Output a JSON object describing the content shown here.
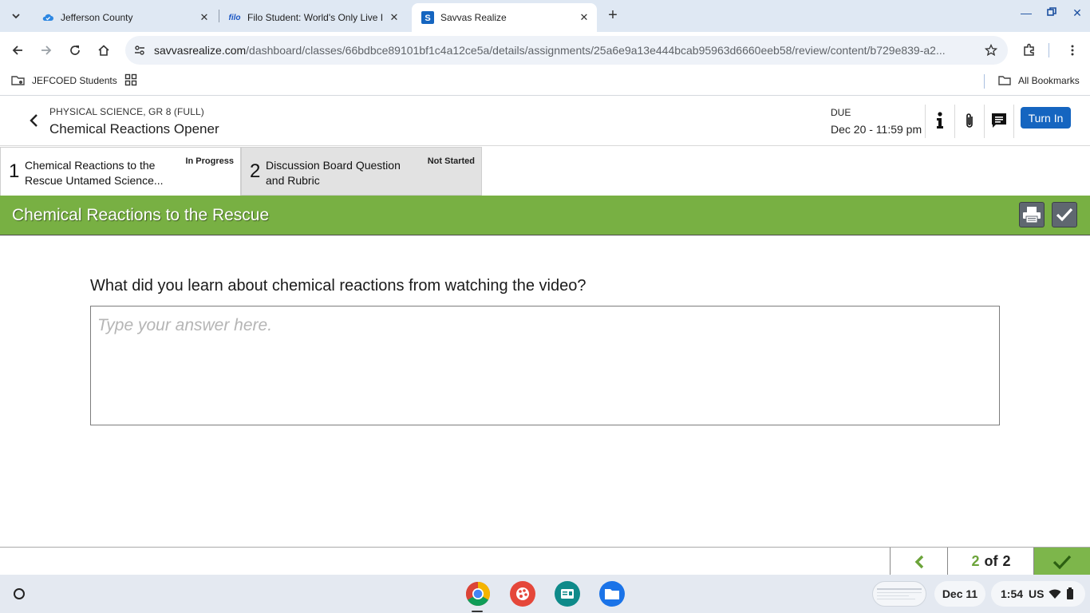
{
  "browser": {
    "tabs": [
      {
        "title": "Jefferson County",
        "active": false
      },
      {
        "title": "Filo Student: World's Only Live I",
        "active": false
      },
      {
        "title": "Savvas Realize",
        "active": true
      }
    ],
    "url_host": "savvasrealize.com",
    "url_path": "/dashboard/classes/66bdbce89101bf1c4a12ce5a/details/assignments/25a6e9a13e444bcab95963d6660eeb58/review/content/b729e839-a2...",
    "bookmarks": {
      "folder": "JEFCOED Students",
      "all_bookmarks": "All Bookmarks"
    }
  },
  "header": {
    "course": "PHYSICAL SCIENCE, GR 8 (FULL)",
    "title": "Chemical Reactions Opener",
    "due_label": "DUE",
    "due_date": "Dec 20 - 11:59 pm",
    "turn_in_label": "Turn In"
  },
  "items": [
    {
      "number": "1",
      "name": "Chemical Reactions to the Rescue Untamed Science...",
      "status": "In Progress"
    },
    {
      "number": "2",
      "name": "Discussion Board Question and Rubric",
      "status": "Not Started"
    }
  ],
  "banner": {
    "title": "Chemical Reactions to the Rescue"
  },
  "question": {
    "prompt": "What did you learn about chemical reactions from watching the video?",
    "answer_value": "",
    "answer_placeholder": "Type your answer here."
  },
  "pager": {
    "current": "2",
    "of_label": "of",
    "total": "2"
  },
  "shelf": {
    "date": "Dec 11",
    "time": "1:54",
    "locale": "US"
  },
  "colors": {
    "banner_green": "#78b043",
    "turn_in_blue": "#1565c0",
    "done_green": "#7db64b"
  }
}
